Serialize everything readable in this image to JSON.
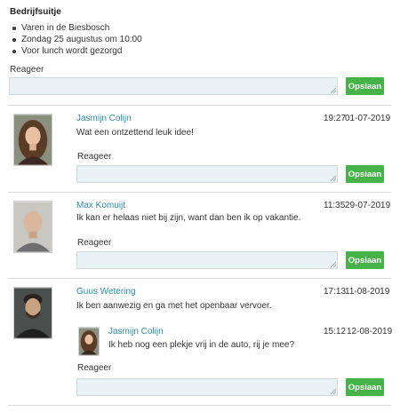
{
  "post": {
    "title": "Bedrijfsuitje",
    "bullets": [
      "Varen in de Biesbosch",
      "Zondag 25 augustus om 10:00",
      "Voor lunch wordt gezorgd"
    ],
    "reply_label": "Reageer",
    "save_label": "Opslaan"
  },
  "comments": [
    {
      "name": "Jasmijn Colijn",
      "time": "19:27",
      "date": "01-07-2019",
      "text": "Wat een ontzettend leuk idee!",
      "reply_label": "Reageer",
      "save_label": "Opslaan"
    },
    {
      "name": "Max Komuijt",
      "time": "11:35",
      "date": "29-07-2019",
      "text": "Ik kan er helaas niet bij zijn, want dan ben ik op vakantie.",
      "reply_label": "Reageer",
      "save_label": "Opslaan"
    },
    {
      "name": "Guus Wetering",
      "time": "17:13",
      "date": "11-08-2019",
      "text": "Ik ben aanwezig en ga met het openbaar vervoer.",
      "reply": {
        "name": "Jasmijn Colijn",
        "time": "15:12",
        "date": "12-08-2019",
        "text": "Ik heb nog een plekje vrij in de auto, rij je mee?"
      },
      "reply_label": "Reageer",
      "save_label": "Opslaan"
    }
  ],
  "colors": {
    "accent_green": "#45b347",
    "name_teal": "#2a8f9c",
    "textarea_bg": "#e8f1f3"
  }
}
